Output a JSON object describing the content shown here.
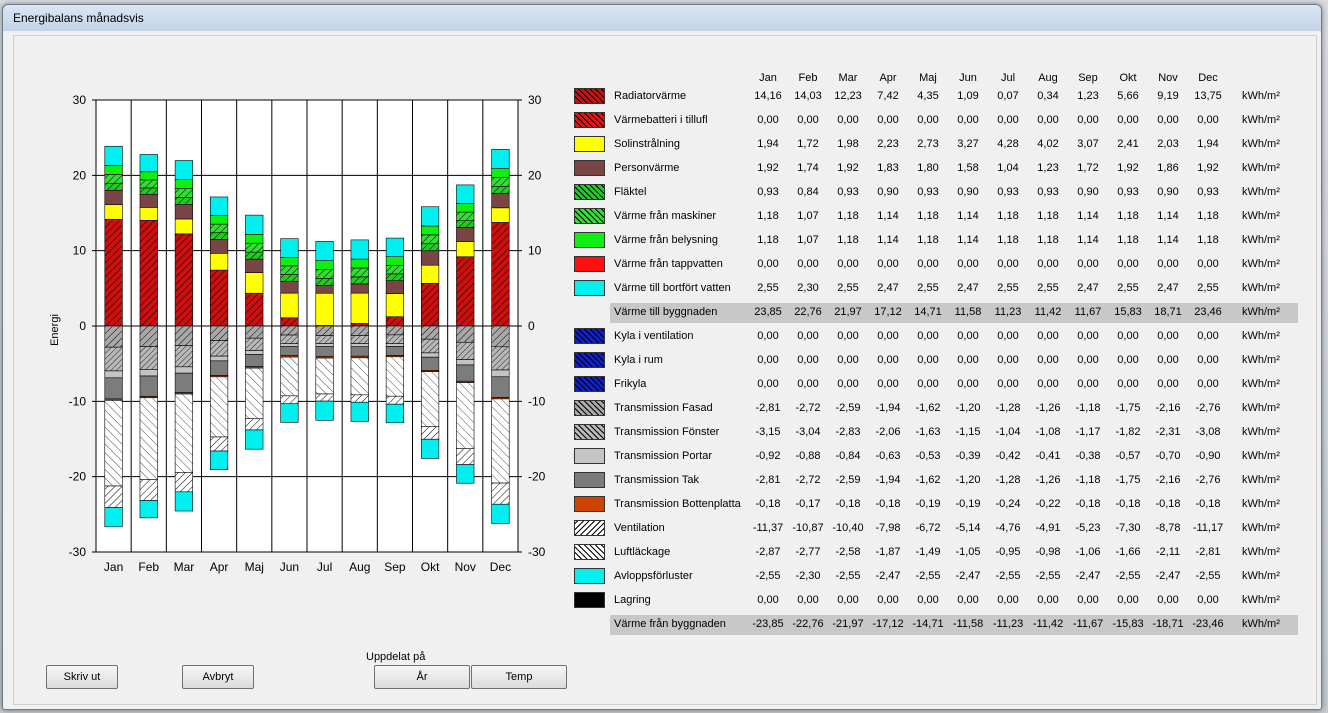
{
  "window": {
    "title": "Energibalans månadsvis"
  },
  "months": [
    "Jan",
    "Feb",
    "Mar",
    "Apr",
    "Maj",
    "Jun",
    "Jul",
    "Aug",
    "Sep",
    "Okt",
    "Nov",
    "Dec"
  ],
  "unit": "kWh/m²",
  "colors": {
    "radiator": "#cc1010",
    "varmebatteri": "#ee1010",
    "sol": "#ffff00",
    "person": "#7a4040",
    "fläktel": "#22cc22",
    "maskiner": "#33dd33",
    "belysning": "#11ee11",
    "tappvatten": "#ff1010",
    "bortfort": "#00ffff",
    "kyla": "#1020cc",
    "transmission": "#b0b0b0",
    "bottenplatta": "#cc4400",
    "ventilation": "#ffffff",
    "lagring": "#000000"
  },
  "rows": [
    {
      "label": "Radiatorvärme",
      "color": "#cc1010",
      "pattern": "hatch",
      "values": [
        "14,16",
        "14,03",
        "12,23",
        "7,42",
        "4,35",
        "1,09",
        "0,07",
        "0,34",
        "1,23",
        "5,66",
        "9,19",
        "13,75"
      ]
    },
    {
      "label": "Värmebatteri i tillufl",
      "color": "#ee1010",
      "pattern": "hatch",
      "values": [
        "0,00",
        "0,00",
        "0,00",
        "0,00",
        "0,00",
        "0,00",
        "0,00",
        "0,00",
        "0,00",
        "0,00",
        "0,00",
        "0,00"
      ]
    },
    {
      "label": "Solinstrålning",
      "color": "#ffff00",
      "pattern": "solid",
      "values": [
        "1,94",
        "1,72",
        "1,98",
        "2,23",
        "2,73",
        "3,27",
        "4,28",
        "4,02",
        "3,07",
        "2,41",
        "2,03",
        "1,94"
      ]
    },
    {
      "label": "Personvärme",
      "color": "#7a4545",
      "pattern": "solid",
      "values": [
        "1,92",
        "1,74",
        "1,92",
        "1,83",
        "1,80",
        "1,58",
        "1,04",
        "1,23",
        "1,72",
        "1,92",
        "1,86",
        "1,92"
      ]
    },
    {
      "label": "Fläktel",
      "color": "#22cc22",
      "pattern": "hatch",
      "values": [
        "0,93",
        "0,84",
        "0,93",
        "0,90",
        "0,93",
        "0,90",
        "0,93",
        "0,93",
        "0,90",
        "0,93",
        "0,90",
        "0,93"
      ]
    },
    {
      "label": "Värme från maskiner",
      "color": "#33dd33",
      "pattern": "hatch",
      "values": [
        "1,18",
        "1,07",
        "1,18",
        "1,14",
        "1,18",
        "1,14",
        "1,18",
        "1,18",
        "1,14",
        "1,18",
        "1,14",
        "1,18"
      ]
    },
    {
      "label": "Värme från belysning",
      "color": "#11ee11",
      "pattern": "solid",
      "values": [
        "1,18",
        "1,07",
        "1,18",
        "1,14",
        "1,18",
        "1,14",
        "1,18",
        "1,18",
        "1,14",
        "1,18",
        "1,14",
        "1,18"
      ]
    },
    {
      "label": "Värme från tappvatten",
      "color": "#ff1010",
      "pattern": "solid",
      "values": [
        "0,00",
        "0,00",
        "0,00",
        "0,00",
        "0,00",
        "0,00",
        "0,00",
        "0,00",
        "0,00",
        "0,00",
        "0,00",
        "0,00"
      ]
    },
    {
      "label": "Värme till bortfört vatten",
      "color": "#00f0f0",
      "pattern": "solid",
      "values": [
        "2,55",
        "2,30",
        "2,55",
        "2,47",
        "2,55",
        "2,47",
        "2,55",
        "2,55",
        "2,47",
        "2,55",
        "2,47",
        "2,55"
      ]
    },
    {
      "label": "Värme till byggnaden",
      "sum": true,
      "values": [
        "23,85",
        "22,76",
        "21,97",
        "17,12",
        "14,71",
        "11,58",
        "11,23",
        "11,42",
        "11,67",
        "15,83",
        "18,71",
        "23,46"
      ]
    },
    {
      "label": "Kyla i ventilation",
      "color": "#1020cc",
      "pattern": "hatch",
      "values": [
        "0,00",
        "0,00",
        "0,00",
        "0,00",
        "0,00",
        "0,00",
        "0,00",
        "0,00",
        "0,00",
        "0,00",
        "0,00",
        "0,00"
      ]
    },
    {
      "label": "Kyla i rum",
      "color": "#1020cc",
      "pattern": "hatch",
      "values": [
        "0,00",
        "0,00",
        "0,00",
        "0,00",
        "0,00",
        "0,00",
        "0,00",
        "0,00",
        "0,00",
        "0,00",
        "0,00",
        "0,00"
      ]
    },
    {
      "label": "Frikyla",
      "color": "#1020cc",
      "pattern": "hatch",
      "values": [
        "0,00",
        "0,00",
        "0,00",
        "0,00",
        "0,00",
        "0,00",
        "0,00",
        "0,00",
        "0,00",
        "0,00",
        "0,00",
        "0,00"
      ]
    },
    {
      "label": "Transmission Fasad",
      "color": "#a8a8a8",
      "pattern": "hatch",
      "values": [
        "-2,81",
        "-2,72",
        "-2,59",
        "-1,94",
        "-1,62",
        "-1,20",
        "-1,28",
        "-1,26",
        "-1,18",
        "-1,75",
        "-2,16",
        "-2,76"
      ]
    },
    {
      "label": "Transmission Fönster",
      "color": "#b8b8b8",
      "pattern": "hatch2",
      "values": [
        "-3,15",
        "-3,04",
        "-2,83",
        "-2,06",
        "-1,63",
        "-1,15",
        "-1,04",
        "-1,08",
        "-1,17",
        "-1,82",
        "-2,31",
        "-3,08"
      ]
    },
    {
      "label": "Transmission Portar",
      "color": "#c4c4c4",
      "pattern": "solid",
      "values": [
        "-0,92",
        "-0,88",
        "-0,84",
        "-0,63",
        "-0,53",
        "-0,39",
        "-0,42",
        "-0,41",
        "-0,38",
        "-0,57",
        "-0,70",
        "-0,90"
      ]
    },
    {
      "label": "Transmission Tak",
      "color": "#7c7c7c",
      "pattern": "solid",
      "values": [
        "-2,81",
        "-2,72",
        "-2,59",
        "-1,94",
        "-1,62",
        "-1,20",
        "-1,28",
        "-1,26",
        "-1,18",
        "-1,75",
        "-2,16",
        "-2,76"
      ]
    },
    {
      "label": "Transmission Bottenplatta",
      "color": "#cc4400",
      "pattern": "solid",
      "values": [
        "-0,18",
        "-0,17",
        "-0,18",
        "-0,18",
        "-0,19",
        "-0,19",
        "-0,24",
        "-0,22",
        "-0,18",
        "-0,18",
        "-0,18",
        "-0,18"
      ]
    },
    {
      "label": "Ventilation",
      "color": "#ffffff",
      "pattern": "hatch3",
      "values": [
        "-11,37",
        "-10,87",
        "-10,40",
        "-7,98",
        "-6,72",
        "-5,14",
        "-4,76",
        "-4,91",
        "-5,23",
        "-7,30",
        "-8,78",
        "-11,17"
      ]
    },
    {
      "label": "Luftläckage",
      "color": "#ffffff",
      "pattern": "hatch",
      "values": [
        "-2,87",
        "-2,77",
        "-2,58",
        "-1,87",
        "-1,49",
        "-1,05",
        "-0,95",
        "-0,98",
        "-1,06",
        "-1,66",
        "-2,11",
        "-2,81"
      ]
    },
    {
      "label": "Avloppsförluster",
      "color": "#00f0f0",
      "pattern": "solid",
      "values": [
        "-2,55",
        "-2,30",
        "-2,55",
        "-2,47",
        "-2,55",
        "-2,47",
        "-2,55",
        "-2,55",
        "-2,47",
        "-2,55",
        "-2,47",
        "-2,55"
      ]
    },
    {
      "label": "Lagring",
      "color": "#000000",
      "pattern": "solid",
      "values": [
        "0,00",
        "0,00",
        "0,00",
        "0,00",
        "0,00",
        "0,00",
        "0,00",
        "0,00",
        "0,00",
        "0,00",
        "0,00",
        "0,00"
      ]
    },
    {
      "label": "Värme från byggnaden",
      "sum": true,
      "values": [
        "-23,85",
        "-22,76",
        "-21,97",
        "-17,12",
        "-14,71",
        "-11,58",
        "-11,23",
        "-11,42",
        "-11,67",
        "-15,83",
        "-18,71",
        "-23,46"
      ]
    }
  ],
  "chart_data": {
    "type": "bar",
    "stacked": true,
    "categories": [
      "Jan",
      "Feb",
      "Mar",
      "Apr",
      "Maj",
      "Jun",
      "Jul",
      "Aug",
      "Sep",
      "Okt",
      "Nov",
      "Dec"
    ],
    "ylabel": "Energi",
    "ylim": [
      -30,
      30
    ],
    "yticks": [
      -30,
      -20,
      -10,
      0,
      10,
      20,
      30
    ],
    "grid": true,
    "series": [
      {
        "name": "Radiatorvärme",
        "values": [
          14.16,
          14.03,
          12.23,
          7.42,
          4.35,
          1.09,
          0.07,
          0.34,
          1.23,
          5.66,
          9.19,
          13.75
        ]
      },
      {
        "name": "Värmebatteri i tillufl",
        "values": [
          0,
          0,
          0,
          0,
          0,
          0,
          0,
          0,
          0,
          0,
          0,
          0
        ]
      },
      {
        "name": "Solinstrålning",
        "values": [
          1.94,
          1.72,
          1.98,
          2.23,
          2.73,
          3.27,
          4.28,
          4.02,
          3.07,
          2.41,
          2.03,
          1.94
        ]
      },
      {
        "name": "Personvärme",
        "values": [
          1.92,
          1.74,
          1.92,
          1.83,
          1.8,
          1.58,
          1.04,
          1.23,
          1.72,
          1.92,
          1.86,
          1.92
        ]
      },
      {
        "name": "Fläktel",
        "values": [
          0.93,
          0.84,
          0.93,
          0.9,
          0.93,
          0.9,
          0.93,
          0.93,
          0.9,
          0.93,
          0.9,
          0.93
        ]
      },
      {
        "name": "Värme från maskiner",
        "values": [
          1.18,
          1.07,
          1.18,
          1.14,
          1.18,
          1.14,
          1.18,
          1.18,
          1.14,
          1.18,
          1.14,
          1.18
        ]
      },
      {
        "name": "Värme från belysning",
        "values": [
          1.18,
          1.07,
          1.18,
          1.14,
          1.18,
          1.14,
          1.18,
          1.18,
          1.14,
          1.18,
          1.14,
          1.18
        ]
      },
      {
        "name": "Värme från tappvatten",
        "values": [
          0,
          0,
          0,
          0,
          0,
          0,
          0,
          0,
          0,
          0,
          0,
          0
        ]
      },
      {
        "name": "Värme till bortfört vatten",
        "values": [
          2.55,
          2.3,
          2.55,
          2.47,
          2.55,
          2.47,
          2.55,
          2.55,
          2.47,
          2.55,
          2.47,
          2.55
        ]
      },
      {
        "name": "Transmission Fasad",
        "values": [
          -2.81,
          -2.72,
          -2.59,
          -1.94,
          -1.62,
          -1.2,
          -1.28,
          -1.26,
          -1.18,
          -1.75,
          -2.16,
          -2.76
        ]
      },
      {
        "name": "Transmission Fönster",
        "values": [
          -3.15,
          -3.04,
          -2.83,
          -2.06,
          -1.63,
          -1.15,
          -1.04,
          -1.08,
          -1.17,
          -1.82,
          -2.31,
          -3.08
        ]
      },
      {
        "name": "Transmission Portar",
        "values": [
          -0.92,
          -0.88,
          -0.84,
          -0.63,
          -0.53,
          -0.39,
          -0.42,
          -0.41,
          -0.38,
          -0.57,
          -0.7,
          -0.9
        ]
      },
      {
        "name": "Transmission Tak",
        "values": [
          -2.81,
          -2.72,
          -2.59,
          -1.94,
          -1.62,
          -1.2,
          -1.28,
          -1.26,
          -1.18,
          -1.75,
          -2.16,
          -2.76
        ]
      },
      {
        "name": "Transmission Bottenplatta",
        "values": [
          -0.18,
          -0.17,
          -0.18,
          -0.18,
          -0.19,
          -0.19,
          -0.24,
          -0.22,
          -0.18,
          -0.18,
          -0.18,
          -0.18
        ]
      },
      {
        "name": "Ventilation",
        "values": [
          -11.37,
          -10.87,
          -10.4,
          -7.98,
          -6.72,
          -5.14,
          -4.76,
          -4.91,
          -5.23,
          -7.3,
          -8.78,
          -11.17
        ]
      },
      {
        "name": "Luftläckage",
        "values": [
          -2.87,
          -2.77,
          -2.58,
          -1.87,
          -1.49,
          -1.05,
          -0.95,
          -0.98,
          -1.06,
          -1.66,
          -2.11,
          -2.81
        ]
      },
      {
        "name": "Avloppsförluster",
        "values": [
          -2.55,
          -2.3,
          -2.55,
          -2.47,
          -2.55,
          -2.47,
          -2.55,
          -2.55,
          -2.47,
          -2.55,
          -2.47,
          -2.55
        ]
      }
    ]
  },
  "buttons": {
    "print": "Skriv ut",
    "cancel": "Avbryt",
    "split_label": "Uppdelat på",
    "year": "År",
    "temp": "Temp"
  }
}
